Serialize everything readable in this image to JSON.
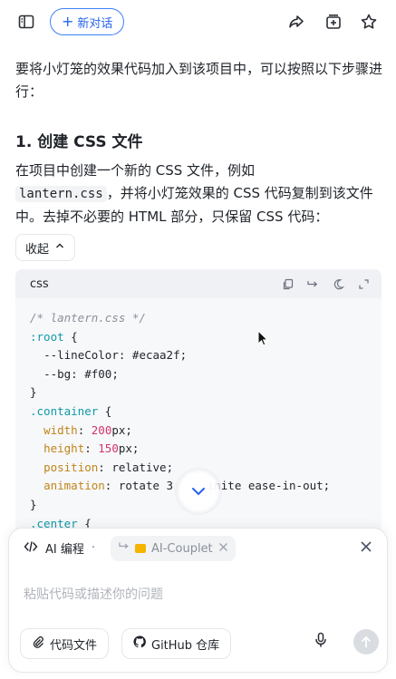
{
  "header": {
    "new_chat_label": "新对话",
    "icons": [
      "sidebar-icon",
      "share-icon",
      "add-to-collection-icon",
      "star-icon"
    ]
  },
  "message": {
    "intro": "要将小灯笼的效果代码加入到该项目中，可以按照以下步骤进行：",
    "heading": "1. 创建 CSS 文件",
    "para_before": "在项目中创建一个新的 CSS 文件，例如",
    "inline_code": "lantern.css",
    "para_after": "，并将小灯笼效果的 CSS 代码复制到该文件中。去掉不必要的 HTML 部分，只保留 CSS 代码：",
    "collapse_label": "收起"
  },
  "code_block": {
    "language": "css",
    "lines": {
      "l1": "/* lantern.css */",
      "l2_sel": ":root",
      "l3_prop": "--lineColor",
      "l3_val": "#ecaa2f",
      "l4_prop": "--bg",
      "l4_val": "#f00",
      "l6_sel": ".container",
      "l7_prop": "width",
      "l7_num": "200",
      "l8_prop": "height",
      "l8_num": "150",
      "l9_prop": "position",
      "l9_val": "relative",
      "l10_prop": "animation",
      "l10_val_a": "rotate 3",
      "l10_val_b": "inite ease-in-out;",
      "l12_sel": ".center"
    }
  },
  "composer": {
    "mode_label": "AI 编程",
    "ref_label": "AI-Couplet",
    "placeholder": "粘贴代码或描述你的问题",
    "code_file_label": "代码文件",
    "github_label": "GitHub 仓库"
  },
  "colors": {
    "accent": "#2563eb",
    "selector": "#0e9aa7",
    "property": "#c0841a",
    "number": "#d6336c"
  }
}
